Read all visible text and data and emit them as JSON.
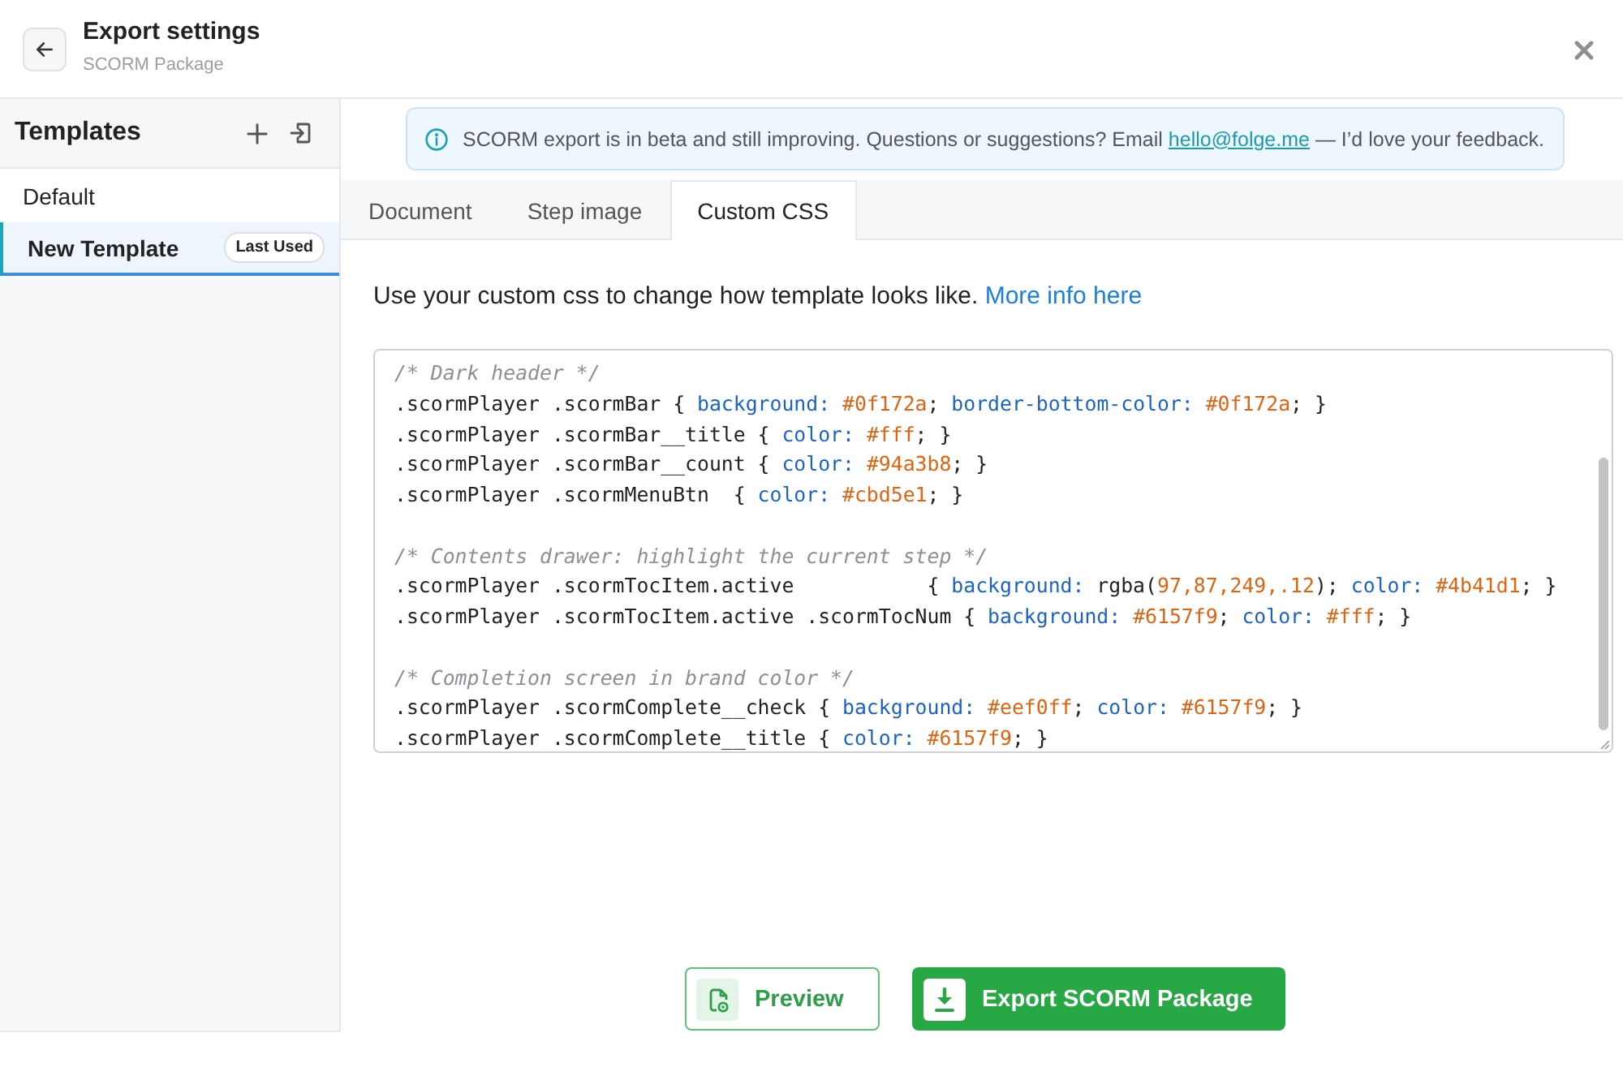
{
  "header": {
    "title": "Export settings",
    "subtitle": "SCORM Package"
  },
  "sidebar": {
    "title": "Templates",
    "items": [
      {
        "label": "Default",
        "selected": false
      },
      {
        "label": "New Template",
        "selected": true,
        "badge": "Last Used"
      }
    ]
  },
  "banner": {
    "text": "SCORM export is in beta and still improving. Questions or suggestions? Email ",
    "link": "hello@folge.me",
    "text_after": " — I’d love your feedback."
  },
  "tabs": [
    {
      "label": "Document",
      "selected": false
    },
    {
      "label": "Step image",
      "selected": false
    },
    {
      "label": "Custom CSS",
      "selected": true
    }
  ],
  "custom_css": {
    "description": "Use your custom css to change how template looks like. ",
    "link": "More info here",
    "code_lines": [
      {
        "kind": "code",
        "segments": [
          {
            "kind": "comment",
            "text": "/* Dark header */"
          }
        ]
      },
      {
        "kind": "code",
        "segments": [
          {
            "kind": "plain",
            "text": ".scormPlayer .scormBar { "
          },
          {
            "kind": "property",
            "text": "background: "
          },
          {
            "kind": "value",
            "text": "#0f172a"
          },
          {
            "kind": "plain",
            "text": "; "
          },
          {
            "kind": "property",
            "text": "border-bottom-color: "
          },
          {
            "kind": "value",
            "text": "#0f172a"
          },
          {
            "kind": "plain",
            "text": "; }"
          }
        ]
      },
      {
        "kind": "code",
        "segments": [
          {
            "kind": "plain",
            "text": ".scormPlayer .scormBar__title { "
          },
          {
            "kind": "property",
            "text": "color: "
          },
          {
            "kind": "value",
            "text": "#fff"
          },
          {
            "kind": "plain",
            "text": "; }"
          }
        ]
      },
      {
        "kind": "code",
        "segments": [
          {
            "kind": "plain",
            "text": ".scormPlayer .scormBar__count { "
          },
          {
            "kind": "property",
            "text": "color: "
          },
          {
            "kind": "value",
            "text": "#94a3b8"
          },
          {
            "kind": "plain",
            "text": "; }"
          }
        ]
      },
      {
        "kind": "code",
        "segments": [
          {
            "kind": "plain",
            "text": ".scormPlayer .scormMenuBtn  { "
          },
          {
            "kind": "property",
            "text": "color: "
          },
          {
            "kind": "value",
            "text": "#cbd5e1"
          },
          {
            "kind": "plain",
            "text": "; }"
          }
        ]
      },
      {
        "kind": "blank"
      },
      {
        "kind": "code",
        "segments": [
          {
            "kind": "comment",
            "text": "/* Contents drawer: highlight the current step */"
          }
        ]
      },
      {
        "kind": "code",
        "segments": [
          {
            "kind": "plain",
            "text": ".scormPlayer .scormTocItem.active           { "
          },
          {
            "kind": "property",
            "text": "background:"
          },
          {
            "kind": "plain",
            "text": " rgba("
          },
          {
            "kind": "value",
            "text": "97,87,249,.12"
          },
          {
            "kind": "plain",
            "text": "); "
          },
          {
            "kind": "property",
            "text": "color: "
          },
          {
            "kind": "value",
            "text": "#4b41d1"
          },
          {
            "kind": "plain",
            "text": "; }"
          }
        ]
      },
      {
        "kind": "code",
        "segments": [
          {
            "kind": "plain",
            "text": ".scormPlayer .scormTocItem.active .scormTocNum { "
          },
          {
            "kind": "property",
            "text": "background: "
          },
          {
            "kind": "value",
            "text": "#6157f9"
          },
          {
            "kind": "plain",
            "text": "; "
          },
          {
            "kind": "property",
            "text": "color: "
          },
          {
            "kind": "value",
            "text": "#fff"
          },
          {
            "kind": "plain",
            "text": "; }"
          }
        ]
      },
      {
        "kind": "blank"
      },
      {
        "kind": "code",
        "segments": [
          {
            "kind": "comment",
            "text": "/* Completion screen in brand color */"
          }
        ]
      },
      {
        "kind": "code",
        "segments": [
          {
            "kind": "plain",
            "text": ".scormPlayer .scormComplete__check { "
          },
          {
            "kind": "property",
            "text": "background: "
          },
          {
            "kind": "value",
            "text": "#eef0ff"
          },
          {
            "kind": "plain",
            "text": "; "
          },
          {
            "kind": "property",
            "text": "color: "
          },
          {
            "kind": "value",
            "text": "#6157f9"
          },
          {
            "kind": "plain",
            "text": "; }"
          }
        ]
      },
      {
        "kind": "code",
        "segments": [
          {
            "kind": "plain",
            "text": ".scormPlayer .scormComplete__title { "
          },
          {
            "kind": "property",
            "text": "color: "
          },
          {
            "kind": "value",
            "text": "#6157f9"
          },
          {
            "kind": "plain",
            "text": "; }"
          }
        ]
      }
    ]
  },
  "buttons": [
    {
      "kind": "secondary",
      "label": "Preview"
    },
    {
      "kind": "primary",
      "label": "Export SCORM Package"
    }
  ]
}
